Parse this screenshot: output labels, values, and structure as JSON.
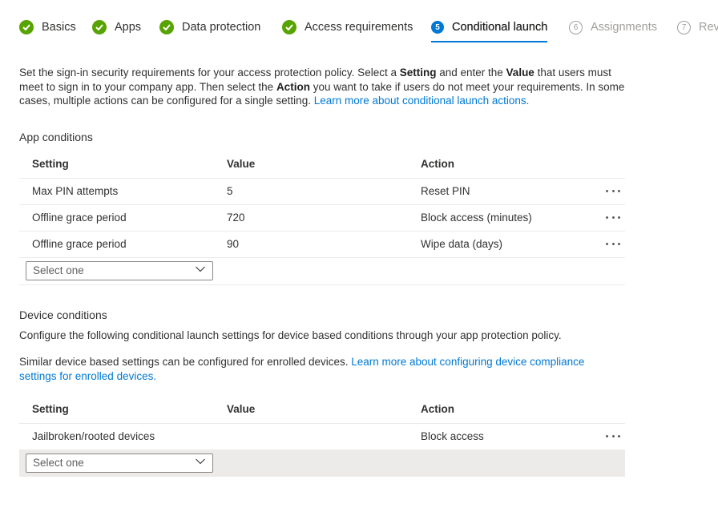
{
  "wizard": {
    "steps": [
      {
        "number": "1",
        "label": "Basics",
        "status": "completed",
        "icon": "check-circle-icon"
      },
      {
        "number": "2",
        "label": "Apps",
        "status": "completed",
        "icon": "check-circle-icon"
      },
      {
        "number": "3",
        "label": "Data protection",
        "status": "completed",
        "icon": "check-circle-icon"
      },
      {
        "number": "4",
        "label": "Access requirements",
        "status": "completed",
        "icon": "check-circle-icon"
      },
      {
        "number": "5",
        "label": "Conditional launch",
        "status": "current"
      },
      {
        "number": "6",
        "label": "Assignments",
        "status": "upcoming"
      },
      {
        "number": "7",
        "label": "Revi",
        "status": "upcoming"
      }
    ],
    "accent_color": "#0078d4",
    "completed_color": "#57a300"
  },
  "intro": {
    "t1": "Set the sign-in security requirements for your access protection policy. Select a ",
    "b1": "Setting",
    "t2": " and enter the ",
    "b2": "Value",
    "t3": " that users must meet to sign in to your company app. Then select the ",
    "b3": "Action",
    "t4": " you want to take if users do not meet your requirements. In some cases, multiple actions can be configured for a single setting. ",
    "link": "Learn more about conditional launch actions."
  },
  "app_conditions": {
    "title": "App conditions",
    "columns": [
      "Setting",
      "Value",
      "Action"
    ],
    "rows": [
      {
        "setting": "Max PIN attempts",
        "value": "5",
        "action": "Reset PIN"
      },
      {
        "setting": "Offline grace period",
        "value": "720",
        "action": "Block access (minutes)"
      },
      {
        "setting": "Offline grace period",
        "value": "90",
        "action": "Wipe data (days)"
      }
    ],
    "select_placeholder": "Select one"
  },
  "device_conditions": {
    "title": "Device conditions",
    "description": "Configure the following conditional launch settings for device based conditions through your app protection policy.",
    "note": "Similar device based settings can be configured for enrolled devices. ",
    "note_link": "Learn more about configuring device compliance settings for enrolled devices.",
    "columns": [
      "Setting",
      "Value",
      "Action"
    ],
    "rows": [
      {
        "setting": "Jailbroken/rooted devices",
        "value": "",
        "action": "Block access"
      }
    ],
    "select_placeholder": "Select one"
  }
}
